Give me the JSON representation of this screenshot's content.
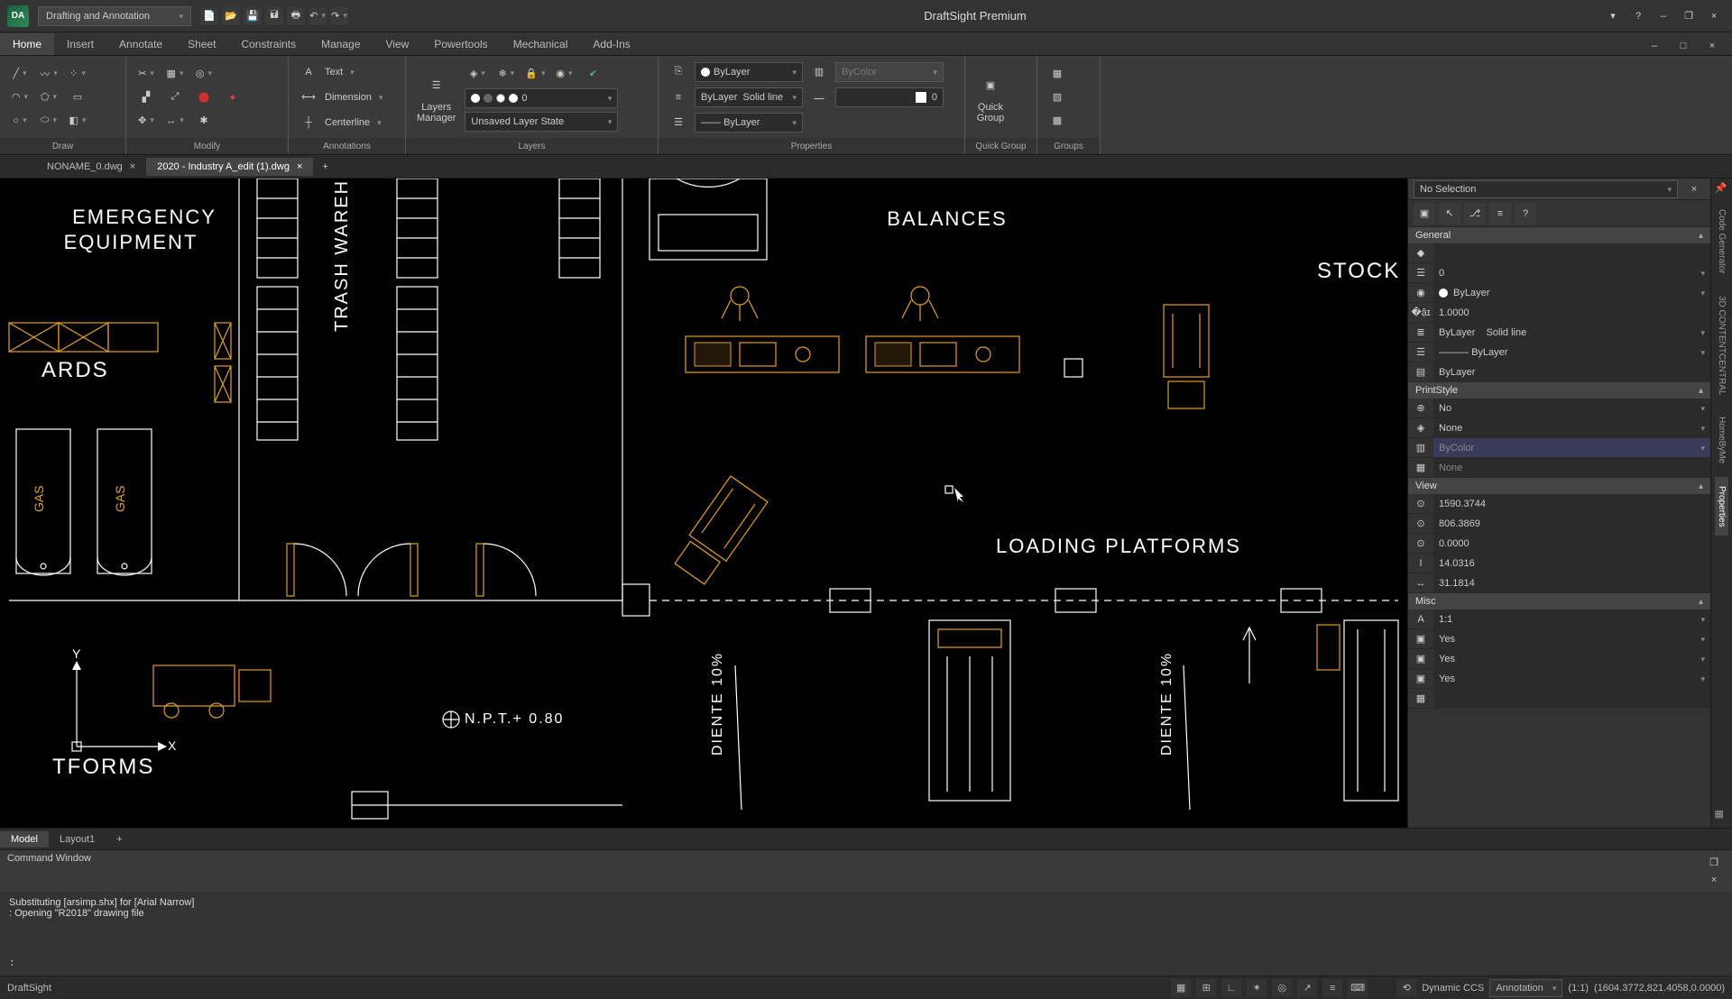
{
  "app": {
    "title": "DraftSight Premium",
    "logo": "DA"
  },
  "workspace": "Drafting and Annotation",
  "menu": {
    "tabs": [
      "Home",
      "Insert",
      "Annotate",
      "Sheet",
      "Constraints",
      "Manage",
      "View",
      "Powertools",
      "Mechanical",
      "Add-Ins"
    ],
    "active": 0
  },
  "ribbon": {
    "panels": [
      "Draw",
      "Modify",
      "Annotations",
      "Layers",
      "Properties",
      "Quick Group",
      "Groups"
    ],
    "text_label": "Text",
    "dimension_label": "Dimension",
    "centerline_label": "Centerline",
    "layers_mgr": "Layers\nManager",
    "layer_state": "Unsaved Layer State",
    "layer_active": "0",
    "prop_layer": "ByLayer",
    "prop_linetype": "Solid line",
    "prop_lineweight": "ByLayer",
    "prop_color": "ByLayer",
    "prop_transparency_label": "ByColor",
    "prop_transparency_val": "0",
    "quick_group": "Quick\nGroup"
  },
  "docs": {
    "tabs": [
      {
        "name": "NONAME_0.dwg"
      },
      {
        "name": "2020 - Industry A_edit (1).dwg"
      }
    ],
    "active": 1
  },
  "drawing": {
    "label_emergency": "EMERGENCY\nEQUIPMENT",
    "label_trash": "TRASH  WAREHO",
    "label_balances": "BALANCES",
    "label_stock": "STOCK  CO",
    "label_ards": "ARDS",
    "label_tforms": "TFORMS",
    "label_loading": "LOADING  PLATFORMS",
    "label_gas1": "GAS",
    "label_gas2": "GAS",
    "label_npt": "N.P.T.+ 0.80",
    "label_diente1": "DIENTE 10%",
    "label_diente2": "DIENTE 10%",
    "axis_x": "X",
    "axis_y": "Y"
  },
  "properties": {
    "selection": "No Selection",
    "sections": {
      "general": {
        "title": "General",
        "color": "",
        "layer": "0",
        "linecolor": "ByLayer",
        "scale": "1.0000",
        "ltype": "ByLayer",
        "ltype2": "Solid line",
        "lweight": "ByLayer",
        "pstyle_name": "ByLayer"
      },
      "print": {
        "title": "PrintStyle",
        "on": "No",
        "style": "None",
        "bycolor": "ByColor",
        "table": "None"
      },
      "view": {
        "title": "View",
        "cx": "1590.3744",
        "cy": "806.3869",
        "cz": "0.0000",
        "h": "14.0316",
        "w": "31.1814"
      },
      "misc": {
        "title": "Misc",
        "anno": "1:1",
        "v1": "Yes",
        "v2": "Yes",
        "v3": "Yes"
      }
    }
  },
  "side_tabs": [
    "Code Generator",
    "3D CONTENTCENTRAL",
    "HomeByMe",
    "Properties"
  ],
  "layout": {
    "tabs": [
      "Model",
      "Layout1"
    ],
    "active": 0
  },
  "command": {
    "title": "Command Window",
    "line1": "Substituting [arsimp.shx] for [Arial Narrow]",
    "line2": ": Opening \"R2018\" drawing file",
    "prompt": ":"
  },
  "status": {
    "app": "DraftSight",
    "dccs": "Dynamic CCS",
    "anno": "Annotation",
    "scale": "(1:1)",
    "coords": "(1604.3772,821.4058,0.0000)"
  }
}
